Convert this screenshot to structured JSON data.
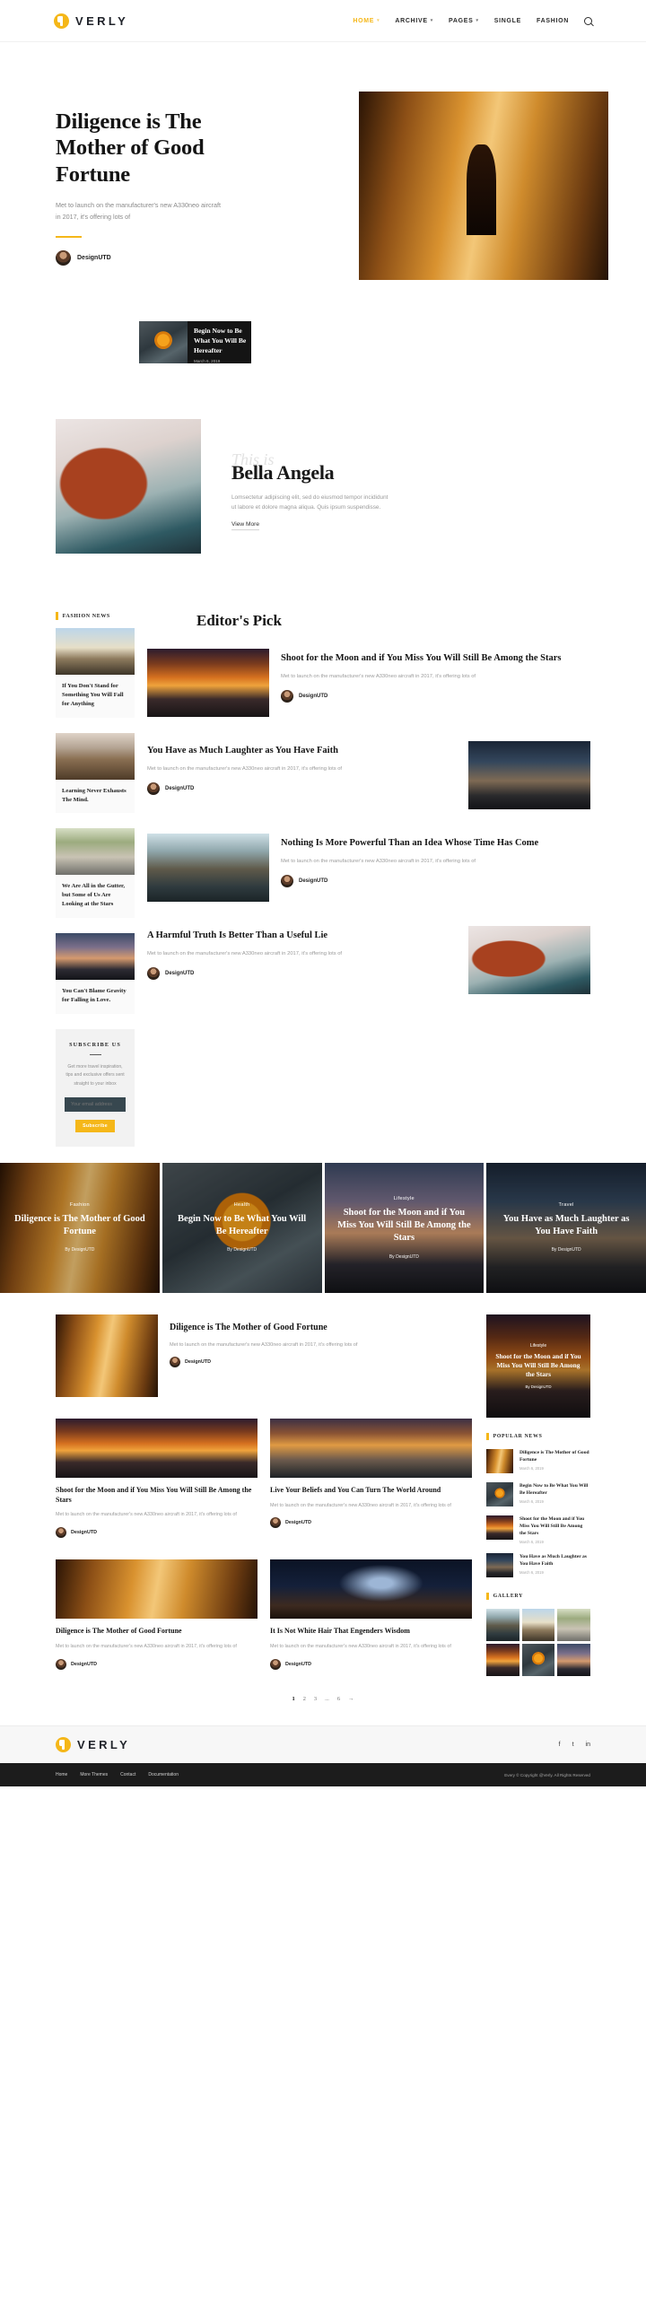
{
  "header": {
    "brand": "VERLY",
    "nav": [
      {
        "label": "HOME",
        "caret": "▾",
        "active": true
      },
      {
        "label": "ARCHIVE",
        "caret": "▾",
        "active": false
      },
      {
        "label": "PAGES",
        "caret": "▾",
        "active": false
      },
      {
        "label": "SINGLE",
        "caret": "",
        "active": false
      },
      {
        "label": "FASHION",
        "caret": "",
        "active": false
      }
    ],
    "search_icon": "search-icon"
  },
  "hero": {
    "title": "Diligence is The Mother of Good Fortune",
    "excerpt": "Met to launch on the manufacturer's new A330neo aircraft in 2017, it's offering lots of",
    "author": "DesignUTD",
    "promo": {
      "title": "Begin Now to Be What You Will Be Hereafter",
      "date": "March 6, 2019"
    }
  },
  "bella": {
    "kicker": "This is",
    "name": "Bella Angela",
    "description": "Lomsectetur adipiscing elit, sed do eiusmod tempor incididunt ut labore et dolore magna aliqua. Quis ipsum suspendisse.",
    "cta": "View More"
  },
  "sidebar": {
    "label": "FASHION NEWS",
    "items": [
      {
        "title": "If You Don't Stand for Something You Will Fall for Anything",
        "img": "img-hiker"
      },
      {
        "title": "Learning Never Exhausts The Mind.",
        "img": "img-bottle"
      },
      {
        "title": "We Are All in the Gutter, but Some of Us Are Looking at the Stars",
        "img": "img-bike"
      },
      {
        "title": "You Can't Blame Gravity for Falling in Love.",
        "img": "img-plane"
      }
    ],
    "subscribe": {
      "title": "SUBSCRIBE US",
      "copy": "Get more travel inspiration, tips and exclusive offers sent straight to your inbox",
      "placeholder": "Your email address",
      "button": "Subscribe"
    }
  },
  "editors_pick": {
    "heading": "Editor's Pick",
    "excerpt": "Met to launch on the manufacturer's new A330neo aircraft in 2017, it's offering lots of",
    "author": "DesignUTD",
    "articles": [
      {
        "title": "Shoot for the Moon and if You Miss You Will Still Be Among the Stars",
        "img": "img-sunset",
        "reverse": false
      },
      {
        "title": "You Have as Much Laughter as You Have Faith",
        "img": "img-pagoda",
        "reverse": true
      },
      {
        "title": "Nothing Is More Powerful Than an Idea Whose Time Has Come",
        "img": "img-lake",
        "reverse": false
      },
      {
        "title": "A Harmful Truth Is Better Than a Useful Lie",
        "img": "img-leaf",
        "reverse": true
      }
    ]
  },
  "band": {
    "by_prefix": "By ",
    "tiles": [
      {
        "category": "Fashion",
        "title": "Diligence is The Mother of Good Fortune",
        "author": "DesignUTD",
        "img": "img-corridor"
      },
      {
        "category": "Health",
        "title": "Begin Now to Be What You Will Be Hereafter",
        "author": "DesignUTD",
        "img": "img-orange"
      },
      {
        "category": "Lifestyle",
        "title": "Shoot for the Moon and if You Miss You Will Still Be Among the Stars",
        "author": "DesignUTD",
        "img": "img-plane"
      },
      {
        "category": "Travel",
        "title": "You Have as Much Laughter as You Have Faith",
        "author": "DesignUTD",
        "img": "img-pagoda"
      }
    ]
  },
  "lower": {
    "excerpt": "Met to launch on the manufacturer's new A330neo aircraft in 2017, it's offering lots of",
    "author": "DesignUTD",
    "feature": {
      "title": "Diligence is The Mother of Good Fortune",
      "img": "img-corridor"
    },
    "cards": [
      {
        "title": "Shoot for the Moon and if You Miss You Will Still Be Among the Stars",
        "img": "img-sunset"
      },
      {
        "title": "Live Your Beliefs and You Can Turn The World Around",
        "img": "img-beach"
      },
      {
        "title": "Diligence is The Mother of Good Fortune",
        "img": "img-corridor"
      },
      {
        "title": "It Is Not White Hair That Engenders Wisdom",
        "img": "img-stars"
      }
    ]
  },
  "rail": {
    "feature": {
      "category": "Lifestyle",
      "title": "Shoot for the Moon and if You Miss You Will Still Be Among the Stars",
      "by": "By DesignUTD",
      "img": "img-sunset"
    },
    "popular_heading": "POPULAR NEWS",
    "popular": [
      {
        "title": "Diligence is The Mother of Good Fortune",
        "date": "March 6, 2019",
        "img": "img-corridor"
      },
      {
        "title": "Begin Now to Be What You Will Be Hereafter",
        "date": "March 6, 2019",
        "img": "img-orange"
      },
      {
        "title": "Shoot for the Moon and if You Miss You Will Still Be Among the Stars",
        "date": "March 6, 2019",
        "img": "img-sunset"
      },
      {
        "title": "You Have as Much Laughter as You Have Faith",
        "date": "March 6, 2019",
        "img": "img-pagoda"
      }
    ],
    "gallery_heading": "GALLERY",
    "gallery": [
      "img-lake",
      "img-hiker",
      "img-bike",
      "img-sunset",
      "img-orange",
      "img-plane"
    ]
  },
  "pagination": {
    "items": [
      "1",
      "2",
      "3",
      "...",
      "6"
    ],
    "active": "1",
    "next": "→"
  },
  "footer": {
    "brand": "VERLY",
    "social": [
      "f",
      "t",
      "in"
    ],
    "links": [
      "Home",
      "More Themes",
      "Contact",
      "Documentation"
    ],
    "copyright": "Every © Copyright @Verly. All Rights Reserved"
  },
  "colors": {
    "accent": "#f5b719",
    "dark": "#1c1c1c",
    "muted": "#9b9b9b"
  }
}
